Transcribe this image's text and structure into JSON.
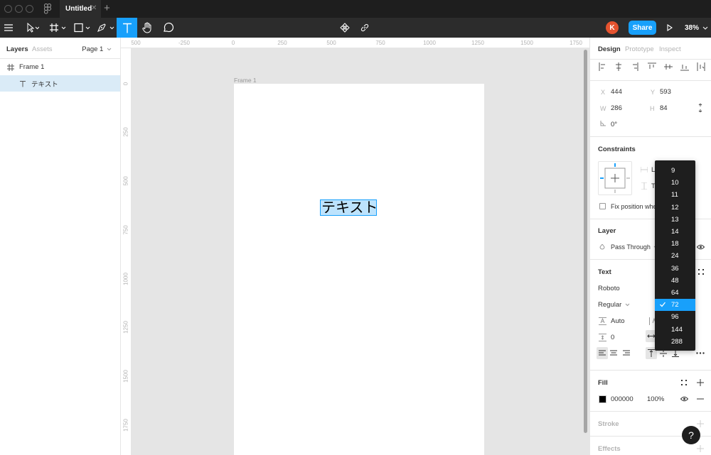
{
  "window": {
    "tab_title": "Untitled",
    "tab_close": "✕",
    "tab_add": "+"
  },
  "toolbar": {
    "avatar_initial": "K",
    "share_label": "Share",
    "zoom_label": "38%"
  },
  "left_panel": {
    "tabs": [
      "Layers",
      "Assets"
    ],
    "page_selector": "Page 1",
    "layers": [
      {
        "name": "Frame 1",
        "icon": "frame-icon"
      },
      {
        "name": "テキスト",
        "icon": "text-icon"
      }
    ]
  },
  "canvas": {
    "frame_label": "Frame 1",
    "text_content": "テキスト",
    "ruler_top_ticks": [
      "-250",
      "0",
      "250",
      "500",
      "750",
      "1000",
      "1250",
      "1500",
      "1750"
    ],
    "ruler_top_partial": "500",
    "ruler_left_ticks": [
      "0",
      "250",
      "500",
      "750",
      "1000",
      "1250",
      "1500",
      "1750"
    ]
  },
  "right_panel": {
    "tabs": [
      "Design",
      "Prototype",
      "Inspect"
    ],
    "position": {
      "x_label": "X",
      "x": "444",
      "y_label": "Y",
      "y": "593",
      "w_label": "W",
      "w": "286",
      "h_label": "H",
      "h": "84",
      "rotation": "0°"
    },
    "constraints": {
      "title": "Constraints",
      "horizontal": "Le",
      "vertical": "To",
      "fix_position": "Fix position whe"
    },
    "layer": {
      "title": "Layer",
      "blend_mode": "Pass Through"
    },
    "text": {
      "title": "Text",
      "font_family": "Roboto",
      "font_weight": "Regular",
      "line_height": "Auto",
      "letter_spacing": "0"
    },
    "fill": {
      "title": "Fill",
      "color_hex": "000000",
      "opacity": "100%"
    },
    "stroke": {
      "title": "Stroke"
    },
    "effects": {
      "title": "Effects"
    }
  },
  "font_size_dropdown": {
    "options": [
      "9",
      "10",
      "11",
      "12",
      "13",
      "14",
      "18",
      "24",
      "36",
      "48",
      "64",
      "72",
      "96",
      "144",
      "288"
    ],
    "selected": "72"
  },
  "help_label": "?",
  "colors": {
    "accent": "#18a0fb",
    "dark": "#2c2c2c",
    "selection": "#daebf7"
  }
}
